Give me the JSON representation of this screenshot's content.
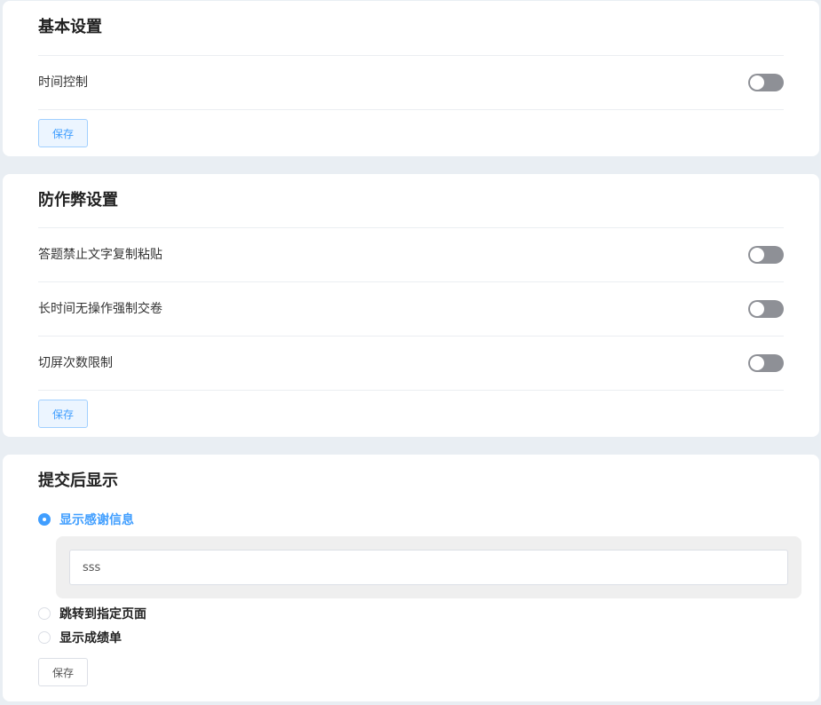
{
  "basic_settings": {
    "title": "基本设置",
    "items": [
      {
        "label": "时间控制",
        "enabled": false
      }
    ],
    "save_label": "保存"
  },
  "anti_cheat": {
    "title": "防作弊设置",
    "items": [
      {
        "label": "答题禁止文字复制粘贴",
        "enabled": false
      },
      {
        "label": "长时间无操作强制交卷",
        "enabled": false
      },
      {
        "label": "切屏次数限制",
        "enabled": false
      }
    ],
    "save_label": "保存"
  },
  "after_submit": {
    "title": "提交后显示",
    "options": [
      {
        "label": "显示感谢信息",
        "selected": true
      },
      {
        "label": "跳转到指定页面",
        "selected": false
      },
      {
        "label": "显示成绩单",
        "selected": false
      }
    ],
    "thanks_message": "sss",
    "save_label": "保存"
  },
  "colors": {
    "accent": "#409eff",
    "toggle_off": "#8e9096",
    "page_background": "#e9eef3"
  }
}
